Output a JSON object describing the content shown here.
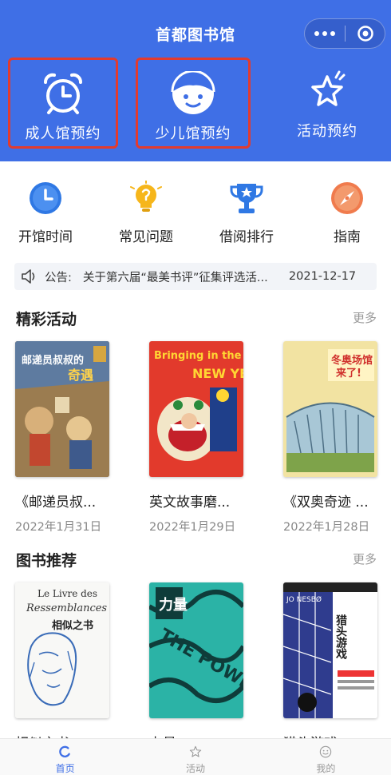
{
  "app": {
    "title": "首都图书馆"
  },
  "entries": [
    {
      "label": "成人馆预约",
      "icon": "alarm-clock-icon"
    },
    {
      "label": "少儿馆预约",
      "icon": "child-face-icon"
    },
    {
      "label": "活动预约",
      "icon": "star-icon"
    }
  ],
  "quick_nav": [
    {
      "label": "开馆时间",
      "icon": "clock-icon"
    },
    {
      "label": "常见问题",
      "icon": "lightbulb-icon"
    },
    {
      "label": "借阅排行",
      "icon": "trophy-icon"
    },
    {
      "label": "指南",
      "icon": "compass-icon"
    }
  ],
  "notice": {
    "prefix": "公告:",
    "text": "关于第六届“最美书评”征集评选活...",
    "date": "2021-12-17"
  },
  "activities": {
    "title": "精彩活动",
    "more": "更多",
    "items": [
      {
        "name": "《邮递员叔...",
        "date": "2022年1月31日",
        "cover_text": "邮递员叔叔的",
        "cover_text2": "奇遇"
      },
      {
        "name": "英文故事磨...",
        "date": "2022年1月29日",
        "cover_text": "Bringing in the",
        "cover_text2": "NEW YEAR"
      },
      {
        "name": "《双奥奇迹 ...",
        "date": "2022年1月28日",
        "cover_text": "冬奥场馆",
        "cover_text2": "来了!"
      }
    ]
  },
  "books": {
    "title": "图书推荐",
    "more": "更多",
    "items": [
      {
        "name": "相似之书",
        "cover_text": "Le Livre des",
        "cover_text2": "Ressemblances",
        "cover_text3": "相似之书"
      },
      {
        "name": "力量",
        "cover_text": "THE POWER",
        "cover_text2": "力量"
      },
      {
        "name": "猎头游戏",
        "cover_text": "JO NESBØ",
        "cover_text2": "猎头游戏"
      }
    ]
  },
  "tabbar": [
    {
      "label": "首页",
      "icon": "home-icon"
    },
    {
      "label": "活动",
      "icon": "star-outline-icon"
    },
    {
      "label": "我的",
      "icon": "smiley-icon"
    }
  ],
  "colors": {
    "brand": "#3f6fe6",
    "highlight_border": "#e23b2e"
  }
}
